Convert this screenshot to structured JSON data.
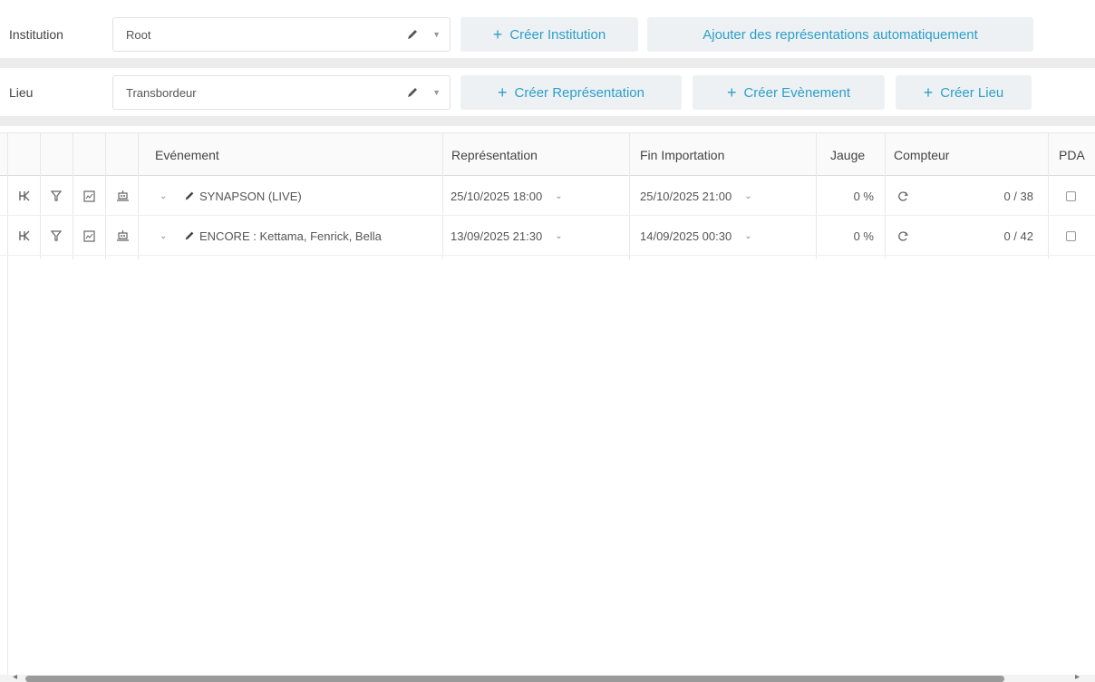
{
  "toolbar": {
    "institution": {
      "label": "Institution",
      "value": "Root",
      "create_button": "Créer Institution",
      "auto_button": "Ajouter des représentations automatiquement"
    },
    "lieu": {
      "label": "Lieu",
      "value": "Transbordeur",
      "create_representation_button": "Créer Représentation",
      "create_event_button": "Créer Evènement",
      "create_lieu_button": "Créer Lieu"
    }
  },
  "table": {
    "columns": {
      "event": "Evénement",
      "representation": "Représentation",
      "fin_importation": "Fin Importation",
      "jauge": "Jauge",
      "compteur": "Compteur",
      "pda": "PDA"
    },
    "rows": [
      {
        "event": "SYNAPSON (LIVE)",
        "representation": "25/10/2025 18:00",
        "fin_importation": "25/10/2025 21:00",
        "jauge": "0 %",
        "compteur": "0 / 38"
      },
      {
        "event": "ENCORE : Kettama, Fenrick, Bella",
        "representation": "13/09/2025 21:30",
        "fin_importation": "14/09/2025 00:30",
        "jauge": "0 %",
        "compteur": "0 / 42"
      }
    ]
  },
  "colors": {
    "accent": "#2b9fc9",
    "button_bg": "#eef1f4",
    "band": "#ececec"
  },
  "icons": {
    "row_actions": [
      "hierarchy-icon",
      "filter-icon",
      "image-icon",
      "ticket-robot-icon"
    ],
    "edit": "pencil-icon",
    "expand": "chevron-down-icon",
    "refresh": "refresh-icon",
    "add": "plus-icon"
  }
}
